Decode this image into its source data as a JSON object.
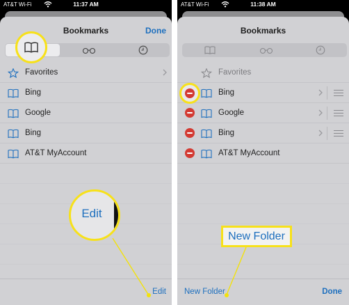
{
  "colors": {
    "accent": "#1d6fbe",
    "callout": "#f7e11a",
    "delete": "#d33a32"
  },
  "left": {
    "status": {
      "carrier": "AT&T Wi-Fi",
      "time": "11:37 AM"
    },
    "title": "Bookmarks",
    "done_label": "Done",
    "segments": [
      {
        "icon": "open-book-icon",
        "selected": true
      },
      {
        "icon": "glasses-icon",
        "selected": false
      },
      {
        "icon": "clock-icon",
        "selected": false
      }
    ],
    "items": [
      {
        "label": "Favorites",
        "icon": "star-icon"
      },
      {
        "label": "Bing",
        "icon": "open-book-icon"
      },
      {
        "label": "Google",
        "icon": "open-book-icon"
      },
      {
        "label": "Bing",
        "icon": "open-book-icon"
      },
      {
        "label": "AT&T MyAccount",
        "icon": "open-book-icon"
      }
    ],
    "toolbar": {
      "edit_label": "Edit"
    },
    "callout": {
      "zoom_text": "Edit"
    }
  },
  "right": {
    "status": {
      "carrier": "AT&T Wi-Fi",
      "time": "11:38 AM"
    },
    "title": "Bookmarks",
    "segments": [
      {
        "icon": "open-book-icon",
        "selected": false
      },
      {
        "icon": "glasses-icon",
        "selected": false
      },
      {
        "icon": "clock-icon",
        "selected": false
      }
    ],
    "items": [
      {
        "label": "Favorites",
        "icon": "star-icon"
      },
      {
        "label": "Bing",
        "icon": "open-book-icon"
      },
      {
        "label": "Google",
        "icon": "open-book-icon"
      },
      {
        "label": "Bing",
        "icon": "open-book-icon"
      },
      {
        "label": "AT&T MyAccount",
        "icon": "open-book-icon"
      }
    ],
    "toolbar": {
      "new_folder_label": "New Folder",
      "done_label": "Done"
    },
    "callout": {
      "label": "New Folder"
    }
  }
}
